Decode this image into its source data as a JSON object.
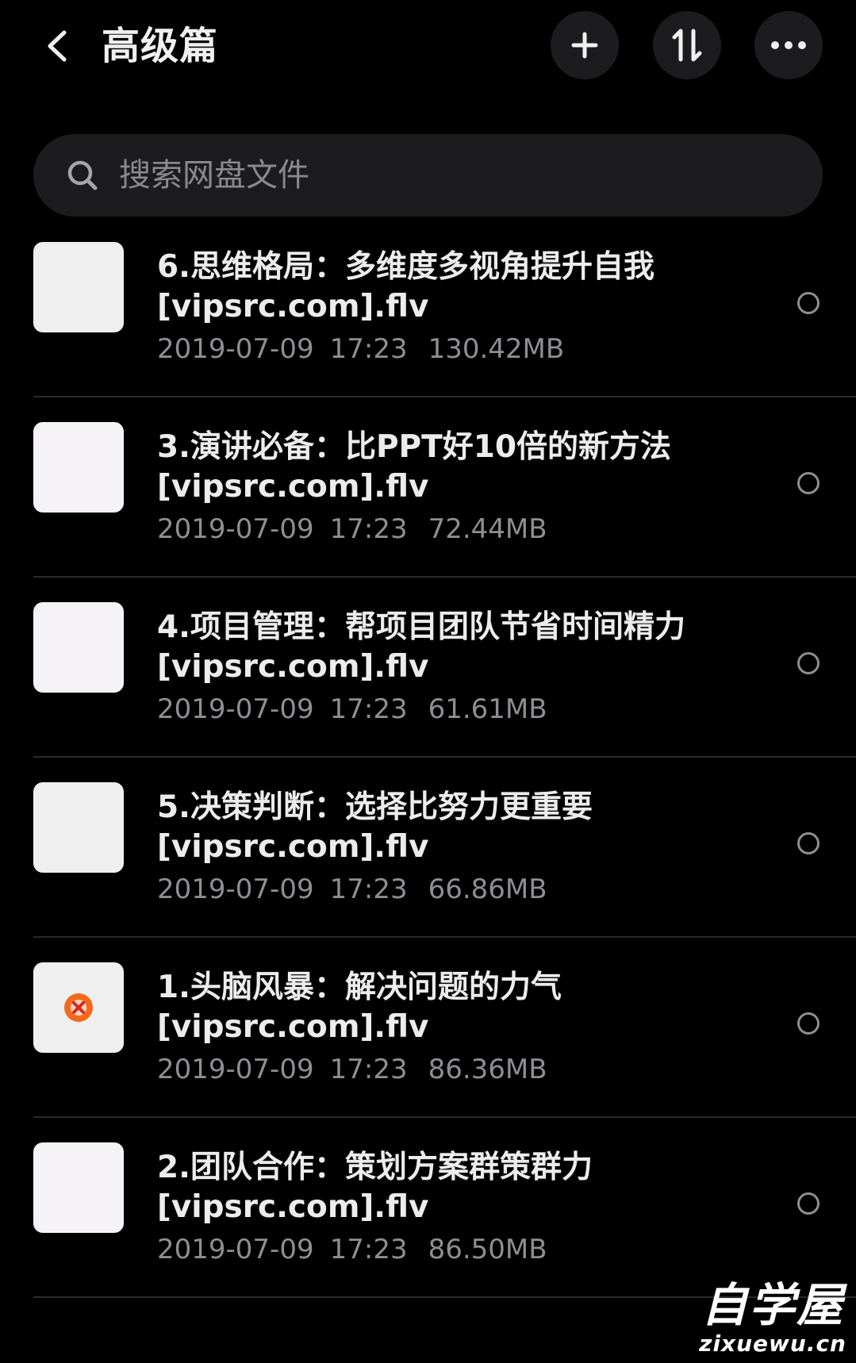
{
  "header": {
    "title": "高级篇",
    "back_icon": "chevron-left-icon",
    "add_icon": "plus-icon",
    "sort_icon": "sort-arrows-icon",
    "more_icon": "more-horizontal-icon"
  },
  "search": {
    "placeholder": "搜索网盘文件",
    "value": "",
    "icon": "search-icon"
  },
  "files": [
    {
      "name": "6.思维格局：多维度多视角提升自我\n[vipsrc.com].flv",
      "date": "2019-07-09",
      "time": "17:23",
      "size": "130.42MB",
      "thumb_color": "#efefef",
      "thumb_icon": ""
    },
    {
      "name": "3.演讲必备：比PPT好10倍的新方法\n[vipsrc.com].flv",
      "date": "2019-07-09",
      "time": "17:23",
      "size": "72.44MB",
      "thumb_color": "#f6f3f6",
      "thumb_icon": ""
    },
    {
      "name": "4.项目管理：帮项目团队节省时间精力\n[vipsrc.com].flv",
      "date": "2019-07-09",
      "time": "17:23",
      "size": "61.61MB",
      "thumb_color": "#f6f3f6",
      "thumb_icon": ""
    },
    {
      "name": "5.决策判断：选择比努力更重要\n[vipsrc.com].flv",
      "date": "2019-07-09",
      "time": "17:23",
      "size": "66.86MB",
      "thumb_color": "#efefef",
      "thumb_icon": ""
    },
    {
      "name": "1.头脑风暴：解决问题的力气\n[vipsrc.com].flv",
      "date": "2019-07-09",
      "time": "17:23",
      "size": "86.36MB",
      "thumb_color": "#efefef",
      "thumb_icon": "video-broken-icon"
    },
    {
      "name": "2.团队合作：策划方案群策群力\n[vipsrc.com].flv",
      "date": "2019-07-09",
      "time": "17:23",
      "size": "86.50MB",
      "thumb_color": "#f6f3f6",
      "thumb_icon": ""
    }
  ],
  "watermark": {
    "main": "自学屋",
    "sub": "zixuewu.cn"
  },
  "colors": {
    "background": "#000000",
    "control_bg": "#1c1c1e",
    "text_primary": "#ececec",
    "text_secondary": "#8e8e93",
    "divider": "#2a2a2c",
    "thumb_badge": "#f26b1d"
  }
}
